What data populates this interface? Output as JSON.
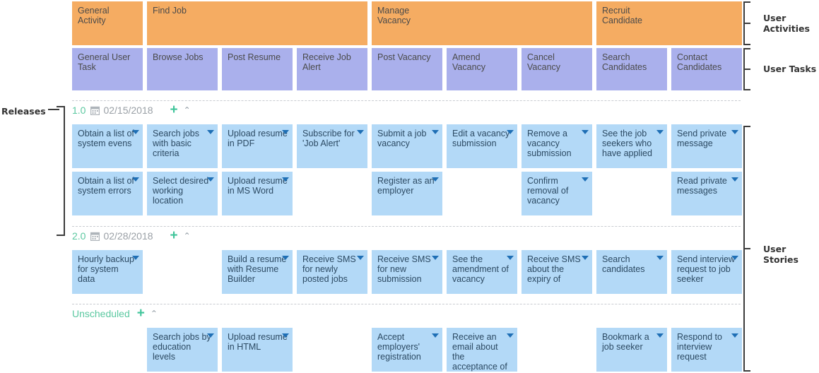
{
  "brackets": {
    "releases_label": "Releases",
    "user_activities_label": "User\nActivities",
    "user_tasks_label": "User Tasks",
    "user_stories_label": "User Stories"
  },
  "icons": {
    "calendar": "calendar-icon",
    "plus": "+",
    "chevron_up": "⌃",
    "caret_down": "caret-down-icon"
  },
  "activities": [
    {
      "label": "General Activity",
      "col": 0,
      "span": 1
    },
    {
      "label": "Find Job",
      "col": 1,
      "span": 3
    },
    {
      "label": "Manage\nVacancy",
      "col": 4,
      "span": 3
    },
    {
      "label": "Recruit\nCandidate",
      "col": 7,
      "span": 2
    }
  ],
  "tasks": [
    {
      "label": "General User\nTask",
      "col": 0
    },
    {
      "label": "Browse Jobs",
      "col": 1
    },
    {
      "label": "Post Resume",
      "col": 2
    },
    {
      "label": "Receive Job\nAlert",
      "col": 3
    },
    {
      "label": "Post Vacancy",
      "col": 4
    },
    {
      "label": "Amend\nVacancy",
      "col": 5
    },
    {
      "label": "Cancel\nVacancy",
      "col": 6
    },
    {
      "label": "Search\nCandidates",
      "col": 7
    },
    {
      "label": "Contact\nCandidates",
      "col": 8
    }
  ],
  "releases": [
    {
      "version": "1.0",
      "date": "02/15/2018",
      "rows": [
        [
          {
            "label": "Obtain a list of\nsystem evens",
            "col": 0
          },
          {
            "label": "Search jobs\nwith basic\ncriteria",
            "col": 1
          },
          {
            "label": "Upload resume\nin PDF",
            "col": 2
          },
          {
            "label": "Subscribe for\n'Job Alert'",
            "col": 3
          },
          {
            "label": "Submit a job\nvacancy",
            "col": 4
          },
          {
            "label": "Edit a vacancy\nsubmission",
            "col": 5
          },
          {
            "label": "Remove a\nvacancy\nsubmission",
            "col": 6
          },
          {
            "label": "See the job\nseekers who\nhave applied",
            "col": 7
          },
          {
            "label": "Send private\nmessage",
            "col": 8
          }
        ],
        [
          {
            "label": "Obtain a list of\nsystem errors",
            "col": 0
          },
          {
            "label": "Select desired\nworking\nlocation",
            "col": 1
          },
          {
            "label": "Upload resume\nin MS Word",
            "col": 2
          },
          {
            "label": "Register as an\nemployer",
            "col": 4
          },
          {
            "label": "Confirm\nremoval of\nvacancy",
            "col": 6
          },
          {
            "label": "Read private\nmessages",
            "col": 8
          }
        ]
      ]
    },
    {
      "version": "2.0",
      "date": "02/28/2018",
      "rows": [
        [
          {
            "label": "Hourly backup\nfor system\ndata",
            "col": 0
          },
          {
            "label": "Build a resume\nwith Resume\nBuilder",
            "col": 2
          },
          {
            "label": "Receive SMS\nfor newly\nposted jobs",
            "col": 3
          },
          {
            "label": "Receive SMS\nfor new\nsubmission",
            "col": 4
          },
          {
            "label": "See the\namendment of\nvacancy",
            "col": 5
          },
          {
            "label": "Receive SMS\nabout the\nexpiry of",
            "col": 6
          },
          {
            "label": "Search\ncandidates",
            "col": 7
          },
          {
            "label": "Send interview\nrequest to job\nseeker",
            "col": 8
          }
        ]
      ]
    }
  ],
  "unscheduled": {
    "label": "Unscheduled",
    "rows": [
      [
        {
          "label": "Search jobs by\neducation\nlevels",
          "col": 1
        },
        {
          "label": "Upload resume\nin HTML",
          "col": 2
        },
        {
          "label": "Accept\nemployers'\nregistration",
          "col": 4
        },
        {
          "label": "Receive an\nemail about the\nacceptance of",
          "col": 5
        },
        {
          "label": "Bookmark a\njob seeker",
          "col": 7
        },
        {
          "label": "Respond to\ninterview\nrequest",
          "col": 8
        }
      ]
    ]
  },
  "colors": {
    "activity": "#f5ac62",
    "task": "#aab0ec",
    "story": "#b3d9f7",
    "release_green": "#5bc8a0",
    "plus_green": "#3fc49a",
    "date_gray": "#9aa0a6"
  }
}
